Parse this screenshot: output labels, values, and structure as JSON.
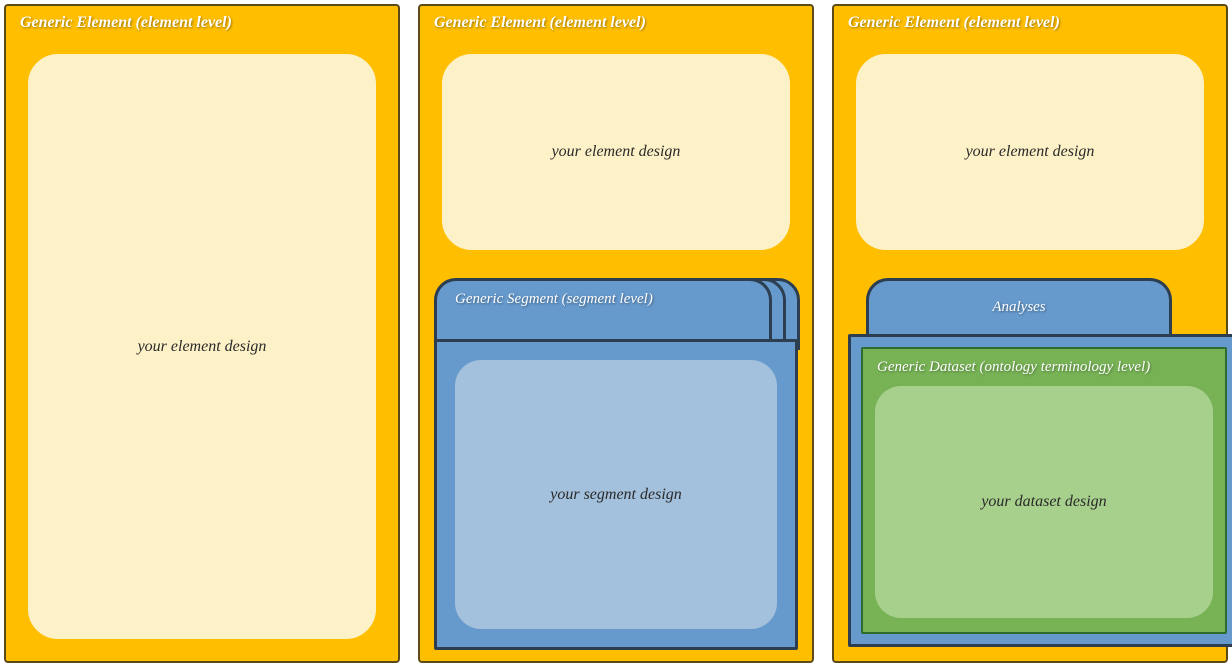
{
  "panel1": {
    "title": "Generic Element (element level)",
    "cream": "your element design"
  },
  "panel2": {
    "title": "Generic Element (element level)",
    "cream": "your element design",
    "segment_title": "Generic Segment (segment level)",
    "segment_inner": "your segment design"
  },
  "panel3": {
    "title": "Generic Element (element level)",
    "cream": "your element design",
    "analyses_title": "Analyses",
    "dataset_title": "Generic Dataset (ontology terminology level)",
    "dataset_inner": "your dataset design"
  }
}
